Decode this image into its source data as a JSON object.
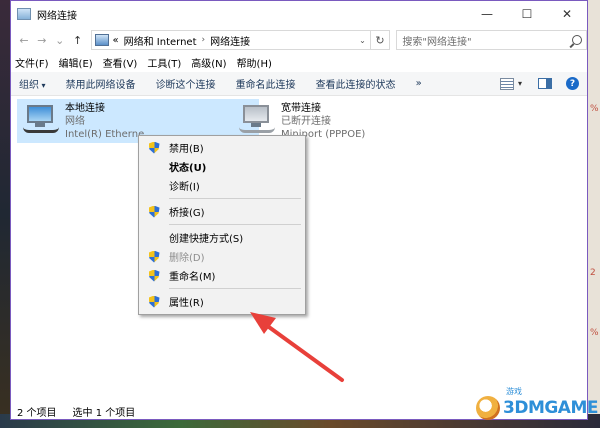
{
  "window": {
    "title": "网络连接"
  },
  "window_controls": {
    "minimize": "—",
    "maximize": "☐",
    "close": "✕"
  },
  "nav": {
    "back": "←",
    "forward": "→",
    "recent": "⌄",
    "up": "↑"
  },
  "address": {
    "prefix": "«",
    "crumb1": "网络和 Internet",
    "separator": "›",
    "crumb2": "网络连接",
    "dropdown": "⌄",
    "refresh": "↻"
  },
  "search": {
    "placeholder": "搜索\"网络连接\""
  },
  "menu": [
    "文件(F)",
    "编辑(E)",
    "查看(V)",
    "工具(T)",
    "高级(N)",
    "帮助(H)"
  ],
  "toolbar": {
    "organize": "组织",
    "disable_device": "禁用此网络设备",
    "diagnose": "诊断这个连接",
    "rename": "重命名此连接",
    "view_status": "查看此连接的状态",
    "more": "»",
    "view_caret": "▾",
    "help": "?"
  },
  "connections": [
    {
      "name": "本地连接",
      "type": "网络",
      "device": "Intel(R) Etherne"
    },
    {
      "name": "宽带连接",
      "type": "已断开连接",
      "device": "Miniport (PPPOE)"
    }
  ],
  "context_menu": [
    {
      "label": "禁用(B)",
      "shield": true
    },
    {
      "label": "状态(U)",
      "bold": true
    },
    {
      "label": "诊断(I)"
    },
    {
      "label": "桥接(G)",
      "shield": true
    },
    {
      "label": "创建快捷方式(S)"
    },
    {
      "label": "删除(D)",
      "shield": true,
      "disabled": true
    },
    {
      "label": "重命名(M)",
      "shield": true
    },
    {
      "label": "属性(R)",
      "shield": true
    }
  ],
  "status": {
    "count": "2 个项目",
    "selected": "选中 1 个项目"
  },
  "watermark": {
    "text": "3DMGAME",
    "cn": "游戏"
  },
  "background_right": [
    "%",
    "2",
    "%"
  ],
  "colors": {
    "selection": "#cce8ff",
    "arrow": "#e8403a",
    "accent": "#1a6ac8"
  }
}
